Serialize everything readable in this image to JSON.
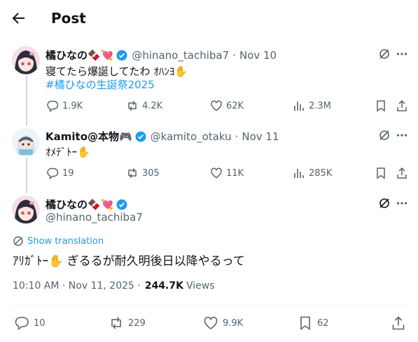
{
  "header": {
    "title": "Post"
  },
  "colors": {
    "accent": "#1d9bf0",
    "muted": "#536471",
    "text": "#0f1419",
    "verified": "#1d9bf0"
  },
  "tweets": [
    {
      "name": "橘ひなの🍫💘",
      "handle": "@hinano_tachiba7",
      "sep": "·",
      "date": "Nov 10",
      "text": "寝てたら爆誕してたわ ｵﾊﾝﾖ✋",
      "hashtag": "#橘ひなの生誕祭2025",
      "replies": "1.9K",
      "reposts": "4.2K",
      "likes": "62K",
      "views": "2.3M"
    },
    {
      "name": "Kamito@本物🎮",
      "handle": "@kamito_otaku",
      "sep": "·",
      "date": "Nov 11",
      "text": "ｵﾒﾃﾞﾄｰ✋",
      "replies": "19",
      "reposts": "305",
      "likes": "11K",
      "views": "285K"
    }
  ],
  "main_post": {
    "name": "橘ひなの🍫💘",
    "handle": "@hinano_tachiba7",
    "translate_label": "Show translation",
    "text": "ｱﾘｶﾞﾄｰ✋ ぎるるが耐久明後日以降やるって",
    "time": "10:10 AM · Nov 11, 2025 ·",
    "views_count": "244.7K",
    "views_label": "Views",
    "replies": "10",
    "reposts": "229",
    "likes": "9.9K",
    "bookmarks": "62"
  }
}
